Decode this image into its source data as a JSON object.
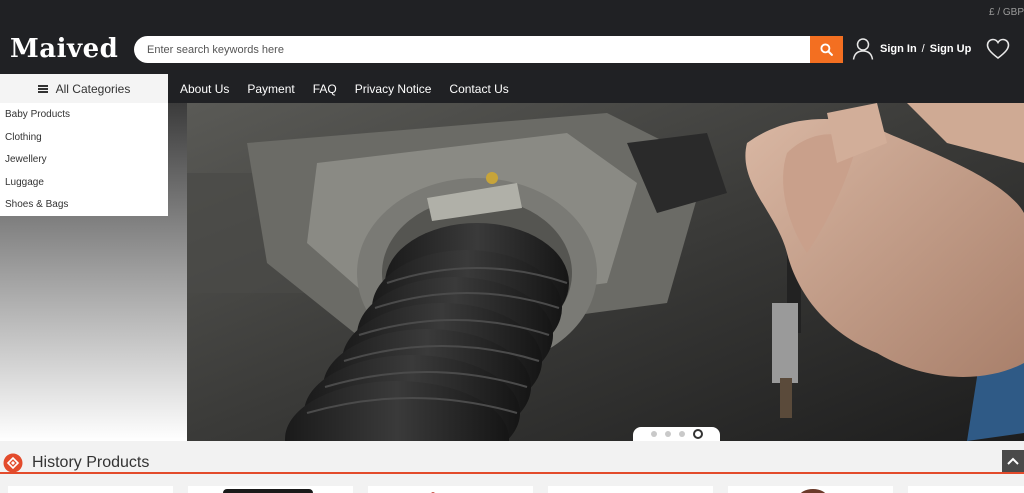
{
  "header": {
    "currency": "£ / GBP",
    "logo": "Maived",
    "search_placeholder": "Enter search keywords here",
    "sign_in": "Sign In",
    "auth_separator": "/",
    "sign_up": "Sign Up"
  },
  "categories": {
    "label": "All Categories",
    "items": [
      "Baby Products",
      "Clothing",
      "Jewellery",
      "Luggage",
      "Shoes & Bags"
    ]
  },
  "nav": {
    "items": [
      "About Us",
      "Payment",
      "FAQ",
      "Privacy Notice",
      "Contact Us"
    ]
  },
  "carousel": {
    "slide_count": 4,
    "active_index": 3
  },
  "history": {
    "title": "History Products"
  },
  "colors": {
    "accent": "#f36f21",
    "header_bg": "#202124",
    "section_line": "#e34b2c"
  }
}
